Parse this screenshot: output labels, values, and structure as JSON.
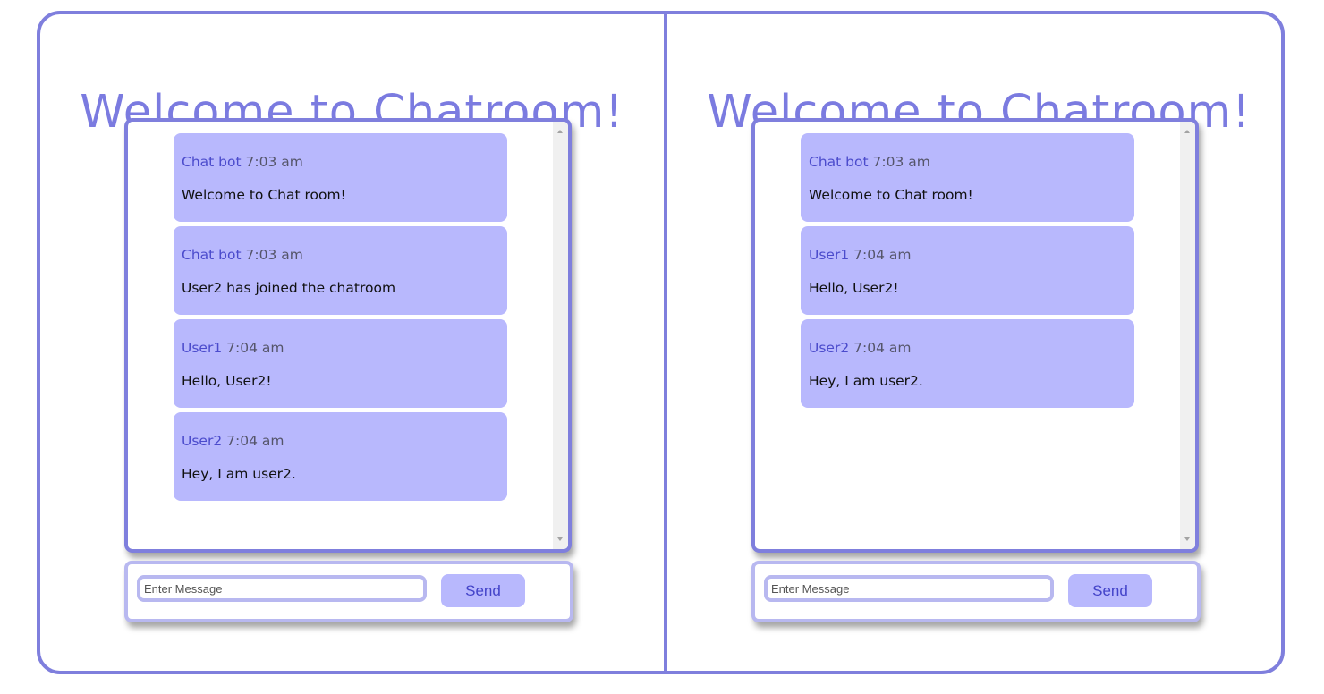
{
  "panes": [
    {
      "title": "Welcome to Chatroom!",
      "messages": [
        {
          "user": "Chat bot",
          "time": "7:03 am",
          "text": "Welcome to Chat room!"
        },
        {
          "user": "Chat bot",
          "time": "7:03 am",
          "text": "User2 has joined the chatroom"
        },
        {
          "user": "User1",
          "time": "7:04 am",
          "text": "Hello, User2!"
        },
        {
          "user": "User2",
          "time": "7:04 am",
          "text": "Hey, I am user2."
        }
      ],
      "input": {
        "placeholder": "Enter Message",
        "value": ""
      },
      "send_label": "Send"
    },
    {
      "title": "Welcome to Chatroom!",
      "messages": [
        {
          "user": "Chat bot",
          "time": "7:03 am",
          "text": "Welcome to Chat room!"
        },
        {
          "user": "User1",
          "time": "7:04 am",
          "text": "Hello, User2!"
        },
        {
          "user": "User2",
          "time": "7:04 am",
          "text": "Hey, I am user2."
        }
      ],
      "input": {
        "placeholder": "Enter Message",
        "value": ""
      },
      "send_label": "Send"
    }
  ],
  "colors": {
    "border": "#7f7fdd",
    "title": "#7b7be0",
    "bubble": "#b8b8fd",
    "username": "#4b4bcc",
    "input_border": "#b8b8f0",
    "send_text": "#4343c9"
  }
}
